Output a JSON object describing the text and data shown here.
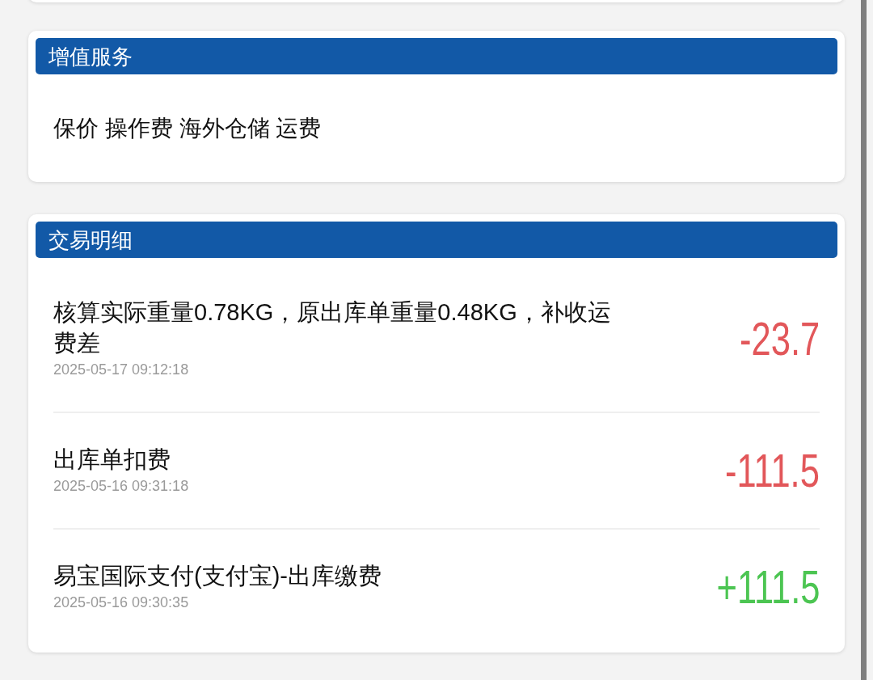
{
  "value_added_services": {
    "title": "增值服务",
    "text": "保价 操作费 海外仓储 运费"
  },
  "transactions": {
    "title": "交易明细",
    "items": [
      {
        "description": "核算实际重量0.78KG，原出库单重量0.48KG，补收运费差",
        "time": "2025-05-17 09:12:18",
        "amount": "-23.7",
        "color": "#e2575a"
      },
      {
        "description": "出库单扣费",
        "time": "2025-05-16 09:31:18",
        "amount": "-111.5",
        "color": "#e2575a"
      },
      {
        "description": "易宝国际支付(支付宝)-出库缴费",
        "time": "2025-05-16 09:30:35",
        "amount": "+111.5",
        "color": "#4cc552"
      }
    ]
  }
}
